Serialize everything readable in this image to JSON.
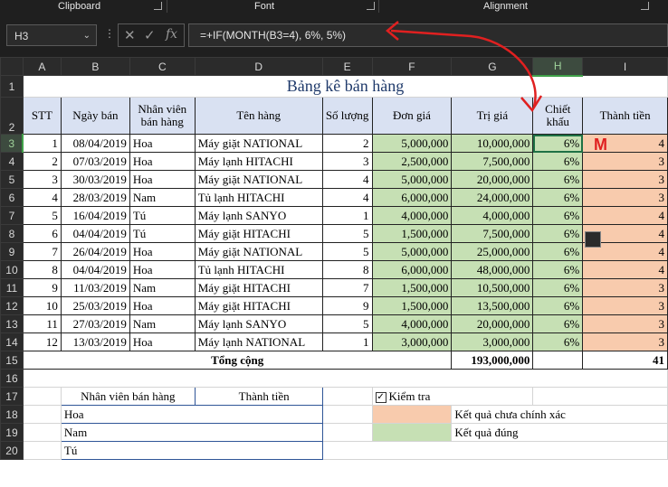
{
  "ribbon": {
    "groups": [
      "Clipboard",
      "Font",
      "Alignment"
    ]
  },
  "formula_bar": {
    "name_box": "H3",
    "formula": "=+IF(MONTH(B3=4), 6%, 5%)"
  },
  "columns": [
    "A",
    "B",
    "C",
    "D",
    "E",
    "F",
    "G",
    "H",
    "I"
  ],
  "rows": [
    "1",
    "2",
    "3",
    "4",
    "5",
    "6",
    "7",
    "8",
    "9",
    "10",
    "11",
    "12",
    "13",
    "14",
    "15",
    "16",
    "17",
    "18",
    "19",
    "20"
  ],
  "sheet": {
    "title": "Bảng kê bán hàng",
    "headers": {
      "stt": "STT",
      "ngay_ban": "Ngày bán",
      "nhan_vien": "Nhân viên bán hàng",
      "ten_hang": "Tên hàng",
      "so_luong": "Số lượng",
      "don_gia": "Đơn giá",
      "tri_gia": "Trị giá",
      "chiet_khau": "Chiết khấu",
      "thanh_tien": "Thành tiền"
    },
    "rows": [
      {
        "stt": "1",
        "ngay": "08/04/2019",
        "nv": "Hoa",
        "hang": "Máy giặt NATIONAL",
        "sl": "2",
        "dg": "5,000,000",
        "tg": "10,000,000",
        "ck": "6%",
        "tt": "4"
      },
      {
        "stt": "2",
        "ngay": "07/03/2019",
        "nv": "Hoa",
        "hang": "Máy lạnh HITACHI",
        "sl": "3",
        "dg": "2,500,000",
        "tg": "7,500,000",
        "ck": "6%",
        "tt": "3"
      },
      {
        "stt": "3",
        "ngay": "30/03/2019",
        "nv": "Hoa",
        "hang": "Máy giặt NATIONAL",
        "sl": "4",
        "dg": "5,000,000",
        "tg": "20,000,000",
        "ck": "6%",
        "tt": "3"
      },
      {
        "stt": "4",
        "ngay": "28/03/2019",
        "nv": "Nam",
        "hang": "Tủ lạnh HITACHI",
        "sl": "4",
        "dg": "6,000,000",
        "tg": "24,000,000",
        "ck": "6%",
        "tt": "3"
      },
      {
        "stt": "5",
        "ngay": "16/04/2019",
        "nv": "Tú",
        "hang": "Máy lạnh SANYO",
        "sl": "1",
        "dg": "4,000,000",
        "tg": "4,000,000",
        "ck": "6%",
        "tt": "4"
      },
      {
        "stt": "6",
        "ngay": "04/04/2019",
        "nv": "Tú",
        "hang": "Máy giặt HITACHI",
        "sl": "5",
        "dg": "1,500,000",
        "tg": "7,500,000",
        "ck": "6%",
        "tt": "4"
      },
      {
        "stt": "7",
        "ngay": "26/04/2019",
        "nv": "Hoa",
        "hang": "Máy giặt NATIONAL",
        "sl": "5",
        "dg": "5,000,000",
        "tg": "25,000,000",
        "ck": "6%",
        "tt": "4"
      },
      {
        "stt": "8",
        "ngay": "04/04/2019",
        "nv": "Hoa",
        "hang": "Tủ lạnh HITACHI",
        "sl": "8",
        "dg": "6,000,000",
        "tg": "48,000,000",
        "ck": "6%",
        "tt": "4"
      },
      {
        "stt": "9",
        "ngay": "11/03/2019",
        "nv": "Nam",
        "hang": "Máy giặt HITACHI",
        "sl": "7",
        "dg": "1,500,000",
        "tg": "10,500,000",
        "ck": "6%",
        "tt": "3"
      },
      {
        "stt": "10",
        "ngay": "25/03/2019",
        "nv": "Hoa",
        "hang": "Máy giặt HITACHI",
        "sl": "9",
        "dg": "1,500,000",
        "tg": "13,500,000",
        "ck": "6%",
        "tt": "3"
      },
      {
        "stt": "11",
        "ngay": "27/03/2019",
        "nv": "Nam",
        "hang": "Máy lạnh SANYO",
        "sl": "5",
        "dg": "4,000,000",
        "tg": "20,000,000",
        "ck": "6%",
        "tt": "3"
      },
      {
        "stt": "12",
        "ngay": "13/03/2019",
        "nv": "Hoa",
        "hang": "Máy lạnh NATIONAL",
        "sl": "1",
        "dg": "3,000,000",
        "tg": "3,000,000",
        "ck": "6%",
        "tt": "3"
      }
    ],
    "total": {
      "label": "Tổng cộng",
      "tri_gia": "193,000,000",
      "thanh_tien": "41"
    }
  },
  "summary": {
    "header_nv": "Nhân viên bán hàng",
    "header_tt": "Thành tiền",
    "names": [
      "Hoa",
      "Nam",
      "Tú"
    ]
  },
  "legend": {
    "check_label": "Kiểm tra",
    "check_mark": "✓",
    "wrong": "Kết quả chưa chính xác",
    "right": "Kết quả đúng"
  },
  "annotation": {
    "mark": "M",
    "color": "#e02020"
  }
}
